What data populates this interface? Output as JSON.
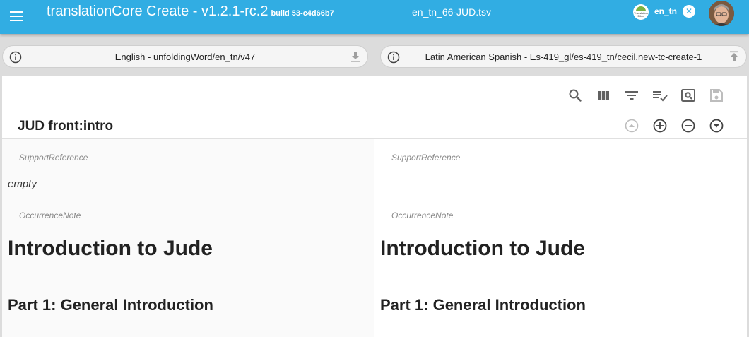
{
  "appbar": {
    "title": "translationCore Create - v1.2.1-rc.2",
    "build": "build 53-c4d66b7",
    "file_name": "en_tn_66-JUD.tsv",
    "org_logo_text": "Translation Bible",
    "org_name": "en_tn",
    "icons": {
      "menu": "menu-icon",
      "close": "close-icon"
    }
  },
  "resources": {
    "left": {
      "label": "English - unfoldingWord/en_tn/v47",
      "action_icon": "download-icon"
    },
    "right": {
      "label": "Latin American Spanish - Es-419_gl/es-419_tn/cecil.new-tc-create-1",
      "action_icon": "upload-icon"
    }
  },
  "toolbar": {
    "icons": [
      "search-icon",
      "view-columns-icon",
      "filter-icon",
      "validate-icon",
      "preview-icon",
      "save-icon"
    ]
  },
  "row": {
    "reference": "JUD front:intro",
    "icons": [
      "move-up-icon",
      "add-row-icon",
      "delete-row-icon",
      "move-down-icon"
    ]
  },
  "source": {
    "support_reference_label": "SupportReference",
    "support_reference_value": "empty",
    "occurrence_note_label": "OccurrenceNote",
    "heading1": "Introduction to Jude",
    "heading2": "Part 1: General Introduction"
  },
  "target": {
    "support_reference_label": "SupportReference",
    "occurrence_note_label": "OccurrenceNote",
    "heading1": "Introduction to Jude",
    "heading2": "Part 1: General Introduction"
  },
  "colors": {
    "appbar": "#31ade3",
    "icon": "#616161",
    "icon_disabled": "#bdbdbd"
  }
}
